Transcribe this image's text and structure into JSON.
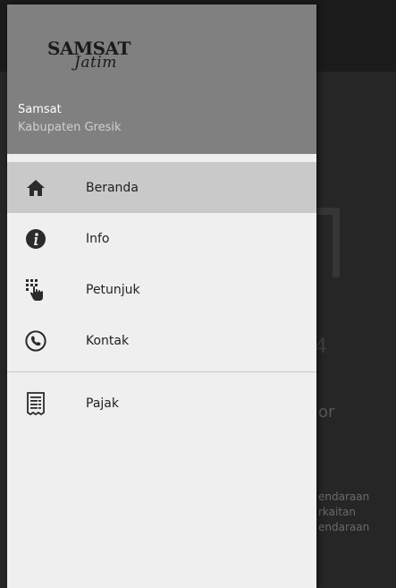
{
  "header": {
    "logo_text": "SAMSAT",
    "logo_script": "Jatim",
    "title": "Samsat",
    "subtitle": "Kabupaten Gresik"
  },
  "menu": {
    "items": [
      {
        "label": "Beranda",
        "icon": "home-icon",
        "active": true
      },
      {
        "label": "Info",
        "icon": "info-icon",
        "active": false
      },
      {
        "label": "Petunjuk",
        "icon": "touch-keypad-icon",
        "active": false
      },
      {
        "label": "Kontak",
        "icon": "phone-icon",
        "active": false
      }
    ],
    "secondary_items": [
      {
        "label": "Pajak",
        "icon": "receipt-icon",
        "active": false
      }
    ]
  },
  "background": {
    "visible_word": "or",
    "visible_lines": "endaraan\nrkaitan\nendaraan"
  },
  "colors": {
    "drawer_bg": "#efefef",
    "header_bg": "#808080",
    "active_item_bg": "#c9c9c9"
  }
}
